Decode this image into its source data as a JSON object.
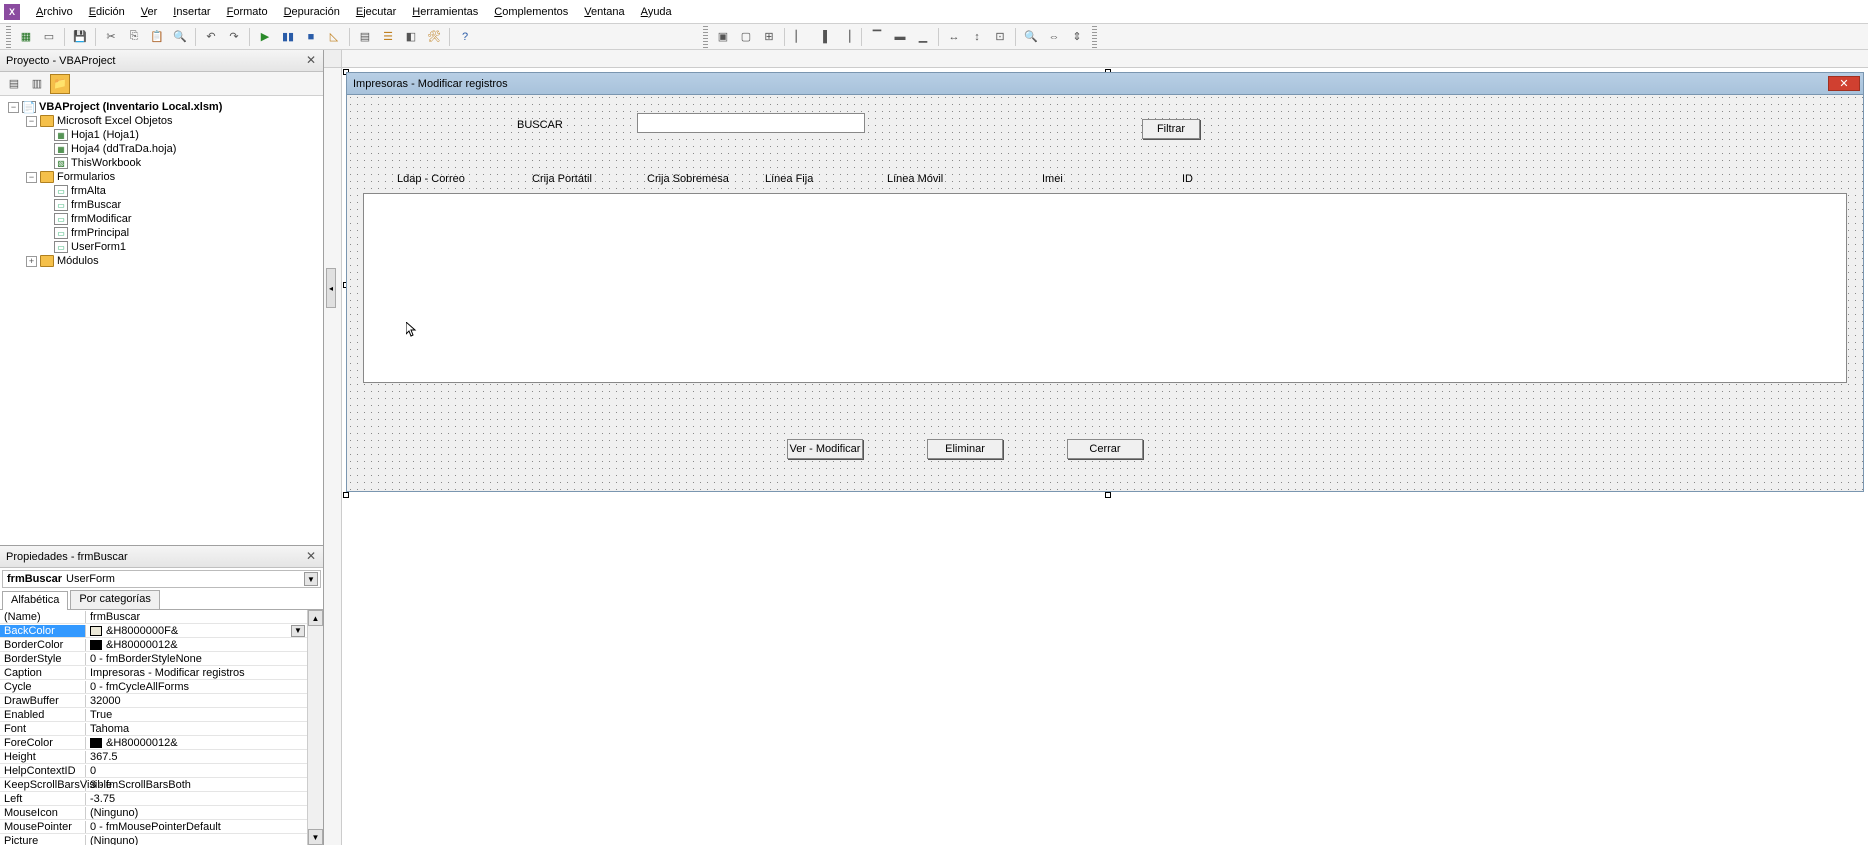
{
  "menu": {
    "items": [
      "Archivo",
      "Edición",
      "Ver",
      "Insertar",
      "Formato",
      "Depuración",
      "Ejecutar",
      "Herramientas",
      "Complementos",
      "Ventana",
      "Ayuda"
    ]
  },
  "project_panel": {
    "title": "Proyecto - VBAProject",
    "root": "VBAProject (Inventario Local.xlsm)",
    "excel_objects_folder": "Microsoft Excel Objetos",
    "sheets": [
      "Hoja1 (Hoja1)",
      "Hoja4 (ddTraDa.hoja)",
      "ThisWorkbook"
    ],
    "forms_folder": "Formularios",
    "forms": [
      "frmAlta",
      "frmBuscar",
      "frmModificar",
      "frmPrincipal",
      "UserForm1"
    ],
    "modules_folder": "Módulos"
  },
  "properties_panel": {
    "title": "Propiedades - frmBuscar",
    "object_name": "frmBuscar",
    "object_type": "UserForm",
    "tab_alpha": "Alfabética",
    "tab_cat": "Por categorías",
    "rows": [
      {
        "k": "(Name)",
        "v": "frmBuscar"
      },
      {
        "k": "BackColor",
        "v": "&H8000000F&",
        "swatch": "#ece9d8"
      },
      {
        "k": "BorderColor",
        "v": "&H80000012&",
        "swatch": "#000000"
      },
      {
        "k": "BorderStyle",
        "v": "0 - fmBorderStyleNone"
      },
      {
        "k": "Caption",
        "v": "Impresoras - Modificar registros"
      },
      {
        "k": "Cycle",
        "v": "0 - fmCycleAllForms"
      },
      {
        "k": "DrawBuffer",
        "v": "32000"
      },
      {
        "k": "Enabled",
        "v": "True"
      },
      {
        "k": "Font",
        "v": "Tahoma"
      },
      {
        "k": "ForeColor",
        "v": "&H80000012&",
        "swatch": "#000000"
      },
      {
        "k": "Height",
        "v": "367.5"
      },
      {
        "k": "HelpContextID",
        "v": "0"
      },
      {
        "k": "KeepScrollBarsVisible",
        "v": "3 - fmScrollBarsBoth"
      },
      {
        "k": "Left",
        "v": "-3.75"
      },
      {
        "k": "MouseIcon",
        "v": "(Ninguno)"
      },
      {
        "k": "MousePointer",
        "v": "0 - fmMousePointerDefault"
      },
      {
        "k": "Picture",
        "v": "(Ninguno)"
      }
    ]
  },
  "form_design": {
    "title": "Impresoras - Modificar registros",
    "search_label": "BUSCAR",
    "filter_btn": "Filtrar",
    "columns": [
      "Ldap - Correo",
      "Crija Portátil",
      "Crija Sobremesa",
      "Línea Fija",
      "Línea Móvil",
      "Imei",
      "ID"
    ],
    "btn_view": "Ver - Modificar",
    "btn_delete": "Eliminar",
    "btn_close": "Cerrar"
  }
}
